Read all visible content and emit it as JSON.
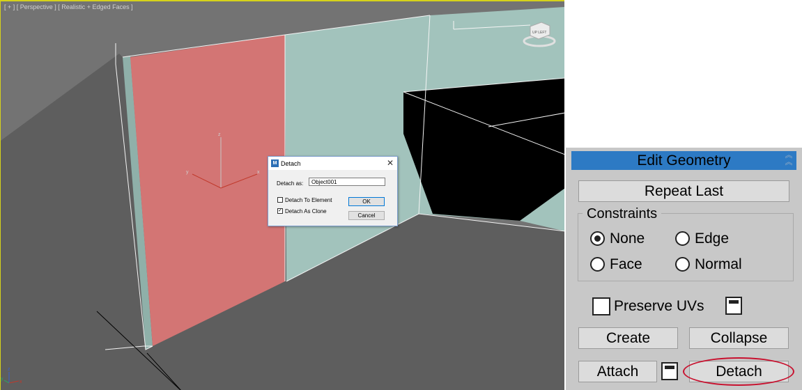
{
  "viewport": {
    "label": "[ + ] [ Perspective ] [ Realistic + Edged Faces ]",
    "axis_labels": {
      "z": "z",
      "y": "y",
      "x": "x"
    },
    "gizmo_axis_labels": {
      "z": "z",
      "y": "y",
      "x": "x"
    },
    "viewcube_label": "UP LEFT",
    "colors": {
      "background": "#737373",
      "border": "#d6d21a",
      "floor": "#5e5e5e",
      "wall": "#a2c3bc",
      "selected_wall": "#d37574",
      "dark_object": "#000000",
      "edges": "#f5f5f5",
      "gizmo": "#c0392b"
    }
  },
  "dialog": {
    "title": "Detach",
    "app_icon": "3ds-max-icon",
    "detach_as_label": "Detach as:",
    "detach_as_value": "Object001",
    "options": [
      {
        "label": "Detach To Element",
        "checked": false
      },
      {
        "label": "Detach As Clone",
        "checked": true
      }
    ],
    "ok_label": "OK",
    "cancel_label": "Cancel"
  },
  "panel": {
    "title": "Edit Geometry",
    "repeat_last_label": "Repeat Last",
    "constraints_label": "Constraints",
    "constraints": [
      {
        "label": "None",
        "checked": true
      },
      {
        "label": "Edge",
        "checked": false
      },
      {
        "label": "Face",
        "checked": false
      },
      {
        "label": "Normal",
        "checked": false
      }
    ],
    "preserve_uvs_label": "Preserve UVs",
    "preserve_uvs_checked": false,
    "create_label": "Create",
    "collapse_label": "Collapse",
    "attach_label": "Attach",
    "detach_label": "Detach",
    "colors": {
      "header": "#2d7ac4",
      "background": "#c8c8c8",
      "highlight": "#c8102e"
    }
  }
}
